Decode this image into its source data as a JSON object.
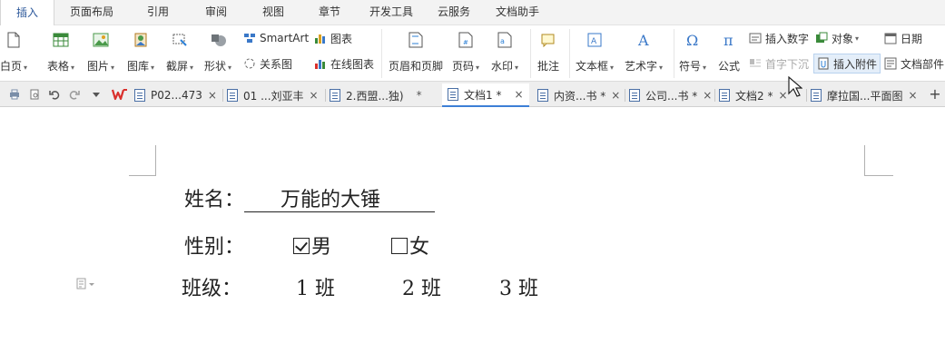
{
  "menu": {
    "tabs": [
      "插入",
      "页面布局",
      "引用",
      "审阅",
      "视图",
      "章节",
      "开发工具",
      "云服务",
      "文档助手"
    ],
    "active": "插入"
  },
  "ribbon": {
    "blank_page": "白页",
    "table": "表格",
    "picture": "图片",
    "gallery": "图库",
    "screenshot": "截屏",
    "shape": "形状",
    "smartart": "SmartArt",
    "chart": "图表",
    "relation_chart": "关系图",
    "online_chart": "在线图表",
    "header_footer": "页眉和页脚",
    "page_number": "页码",
    "watermark": "水印",
    "comment": "批注",
    "textbox": "文本框",
    "wordart": "艺术字",
    "symbol": "符号",
    "formula": "公式",
    "insert_number": "插入数字",
    "drop_cap": "首字下沉",
    "object": "对象",
    "insert_attachment": "插入附件",
    "date": "日期",
    "doc_parts": "文档部件"
  },
  "doc_tabs": [
    {
      "label": "P02...473",
      "close": "×"
    },
    {
      "label": "01 ...刘亚丰",
      "close": "×"
    },
    {
      "label": "2.西盟...独)",
      "close": "*"
    },
    {
      "label": "文档1 *",
      "close": "×",
      "active": true
    },
    {
      "label": "内资...书 *",
      "close": "×"
    },
    {
      "label": "公司...书 *",
      "close": "×"
    },
    {
      "label": "文档2 *",
      "close": "×"
    },
    {
      "label": "摩拉国...平面图",
      "close": "×"
    }
  ],
  "new_tab": "+",
  "document": {
    "name_label": "姓名：",
    "name_value": "万能的大锤",
    "gender_label": "性别：",
    "male": "男",
    "female": "女",
    "class_label": "班级：",
    "class1": "1 班",
    "class2": "2 班",
    "class3": "3 班"
  },
  "colors": {
    "accent": "#2b579a",
    "tab_active_underline": "#3c7fd6",
    "wps_red": "#d9302c"
  }
}
